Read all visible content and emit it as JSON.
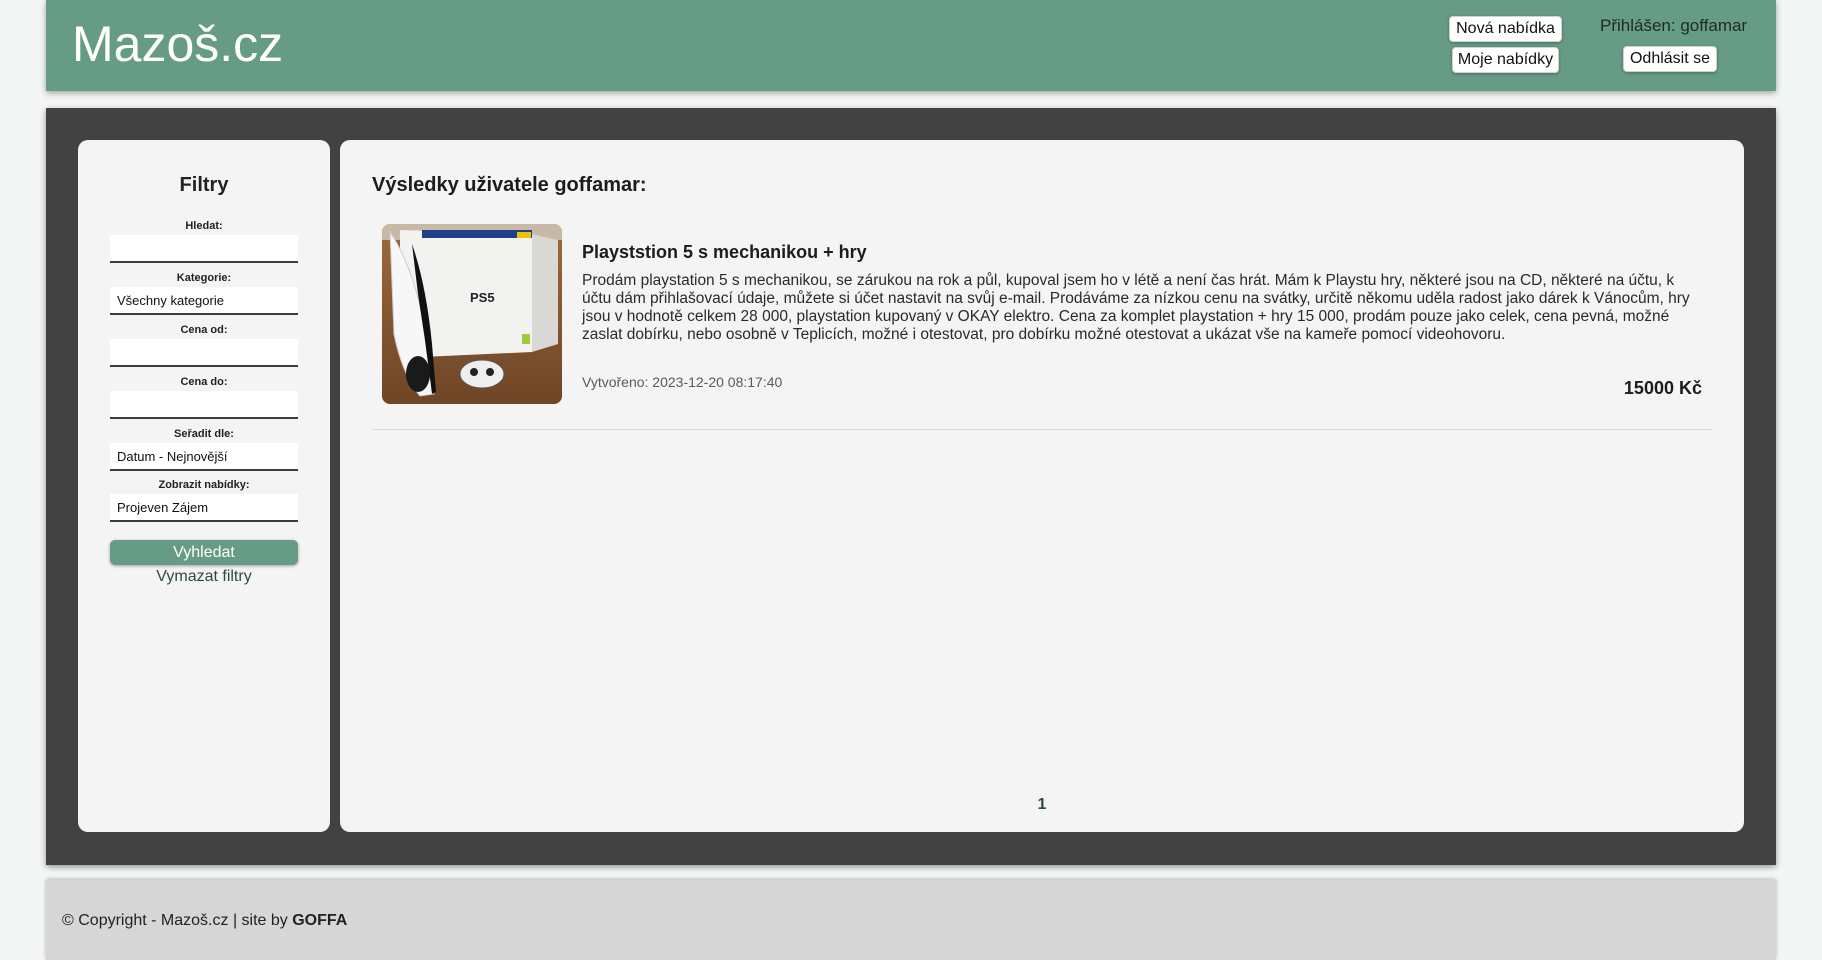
{
  "header": {
    "logo": "Mazoš.cz",
    "new_offer_label": "Nová nabídka",
    "my_offers_label": "Moje nabídky",
    "logged_in_text": "Přihlášen: goffamar",
    "logout_label": "Odhlásit se",
    "brand_color": "#669c86"
  },
  "sidebar": {
    "title": "Filtry",
    "search_label": "Hledat:",
    "search_value": "",
    "category_label": "Kategorie:",
    "category_value": "Všechny kategorie",
    "price_from_label": "Cena od:",
    "price_from_value": "",
    "price_to_label": "Cena do:",
    "price_to_value": "",
    "sort_label": "Seřadit dle:",
    "sort_value": "Datum - Nejnovější",
    "show_label": "Zobrazit nabídky:",
    "show_value": "Projeven Zájem",
    "search_button": "Vyhledat",
    "clear_link": "Vymazat filtry"
  },
  "results": {
    "title": "Výsledky uživatele goffamar:",
    "listings": [
      {
        "title": "Playststion 5 s mechanikou + hry",
        "description": "Prodám playstation 5 s mechanikou, se zárukou na rok a půl, kupoval jsem ho v létě a není čas hrát. Mám k Playstu hry, některé jsou na CD, některé na účtu, k účtu dám přihlašovací údaje, můžete si účet nastavit na svůj e-mail. Prodáváme za nízkou cenu na svátky, určitě někomu uděla radost jako dárek k Vánocům, hry jsou v hodnotě celkem 28 000, playstation kupovaný v OKAY elektro. Cena za komplet playstation + hry 15 000, prodám pouze jako celek, cena pevná, možné zaslat dobírku, nebo osobně v Teplicích, možné i otestovat, pro dobírku možné otestovat a ukázat vše na kameře pomocí videohovoru.",
        "created": "Vytvořeno: 2023-12-20 08:17:40",
        "price": "15000 Kč",
        "image_label": "PS5"
      }
    ],
    "pagination": [
      "1"
    ]
  },
  "footer": {
    "text": "© Copyright - Mazoš.cz | site by ",
    "author": "GOFFA"
  }
}
